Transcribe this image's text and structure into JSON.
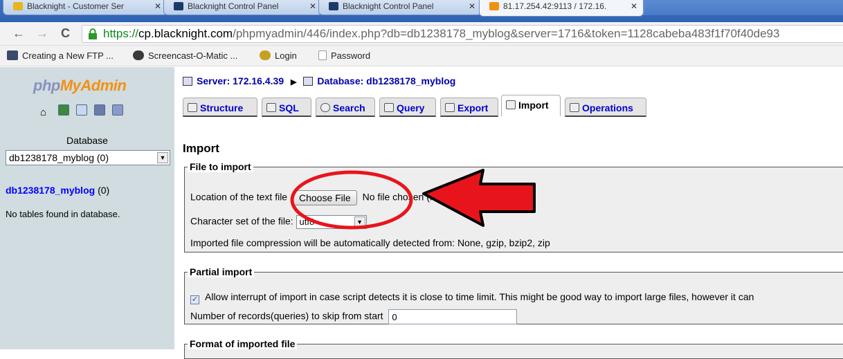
{
  "browser": {
    "tabs": [
      {
        "label": "Blacknight - Customer Ser"
      },
      {
        "label": "Blacknight Control Panel"
      },
      {
        "label": "Blacknight Control Panel"
      },
      {
        "label": "81.17.254.42:9113 / 172.16."
      }
    ],
    "url": {
      "scheme": "https://",
      "host": "cp.blacknight.com",
      "rest": "/phpmyadmin/446/index.php?db=db1238178_myblog&server=1716&token=1128cabeba483f1f70f40de93"
    },
    "bookmarks": [
      {
        "label": "Creating a New FTP ...",
        "icon": "iis-icon",
        "color": "#3a4a6a"
      },
      {
        "label": "Screencast-O-Matic ...",
        "icon": "som-icon",
        "color": "#3a3a3a"
      },
      {
        "label": "Login",
        "icon": "login-icon",
        "color": "#c8a020"
      },
      {
        "label": "Password",
        "icon": "page-icon",
        "color": "#ffffff"
      }
    ]
  },
  "sidebar": {
    "logo": {
      "part1": "php",
      "part2": "My",
      "part3": "Admin"
    },
    "database_caption": "Database",
    "database_select": "db1238178_myblog (0)",
    "db_link_name": "db1238178_myblog",
    "db_link_count": "(0)",
    "no_tables": "No tables found in database."
  },
  "main": {
    "server": "Server: 172.16.4.39",
    "database": "Database: db1238178_myblog",
    "tabs": [
      {
        "label": "Structure"
      },
      {
        "label": "SQL"
      },
      {
        "label": "Search"
      },
      {
        "label": "Query"
      },
      {
        "label": "Export"
      },
      {
        "label": "Import"
      },
      {
        "label": "Operations"
      }
    ],
    "page_title": "Import",
    "file_to_import": {
      "legend": "File to import",
      "location_label": "Location of the text file",
      "choose_button": "Choose File",
      "no_file": "No file chosen",
      "max_size": "(Max: 16,384 KiB)",
      "charset_label": "Character set of the file:",
      "charset_value": "utf8",
      "compression_note": "Imported file compression will be automatically detected from: None, gzip, bzip2, zip"
    },
    "partial_import": {
      "legend": "Partial import",
      "allow_interrupt": "Allow interrupt of import in case script detects it is close to time limit. This might be good way to import large files, however it can",
      "skip_label": "Number of records(queries) to skip from start",
      "skip_value": "0"
    },
    "format": {
      "legend": "Format of imported file"
    }
  },
  "colors": {
    "link": "#0000ff",
    "annotation": "#e8141c",
    "sidebar_bg": "#d0dce0"
  }
}
